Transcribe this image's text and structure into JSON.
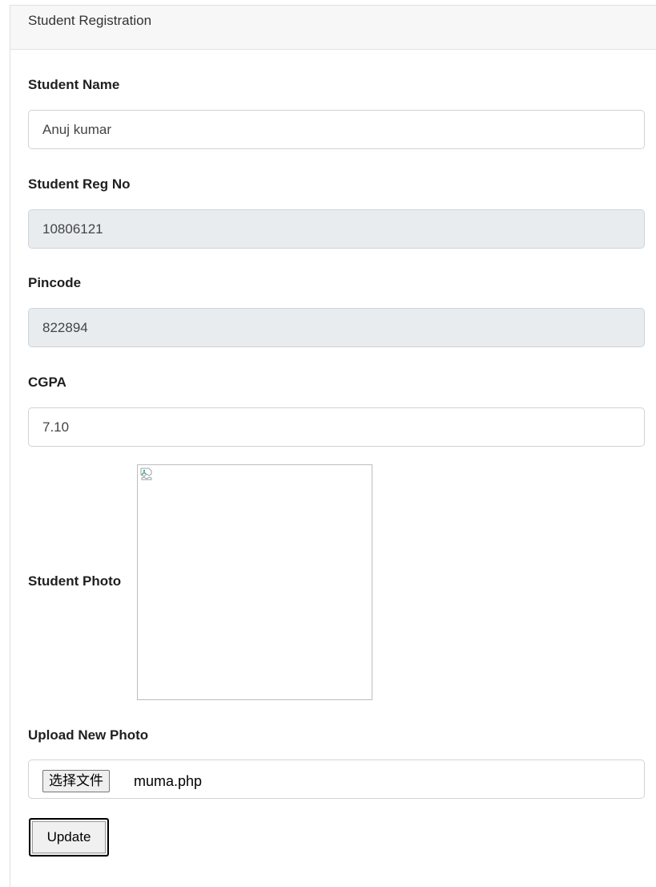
{
  "card": {
    "header_title": "Student Registration"
  },
  "form": {
    "student_name": {
      "label": "Student Name",
      "value": "Anuj kumar"
    },
    "reg_no": {
      "label": "Student Reg No",
      "value": "10806121"
    },
    "pincode": {
      "label": "Pincode",
      "value": "822894"
    },
    "cgpa": {
      "label": "CGPA",
      "value": "7.10"
    },
    "photo": {
      "label": "Student Photo",
      "icon": "broken-image-icon"
    },
    "upload": {
      "label": "Upload New Photo",
      "button_label": "选择文件",
      "file_name": "muma.php"
    },
    "submit_label": "Update"
  }
}
